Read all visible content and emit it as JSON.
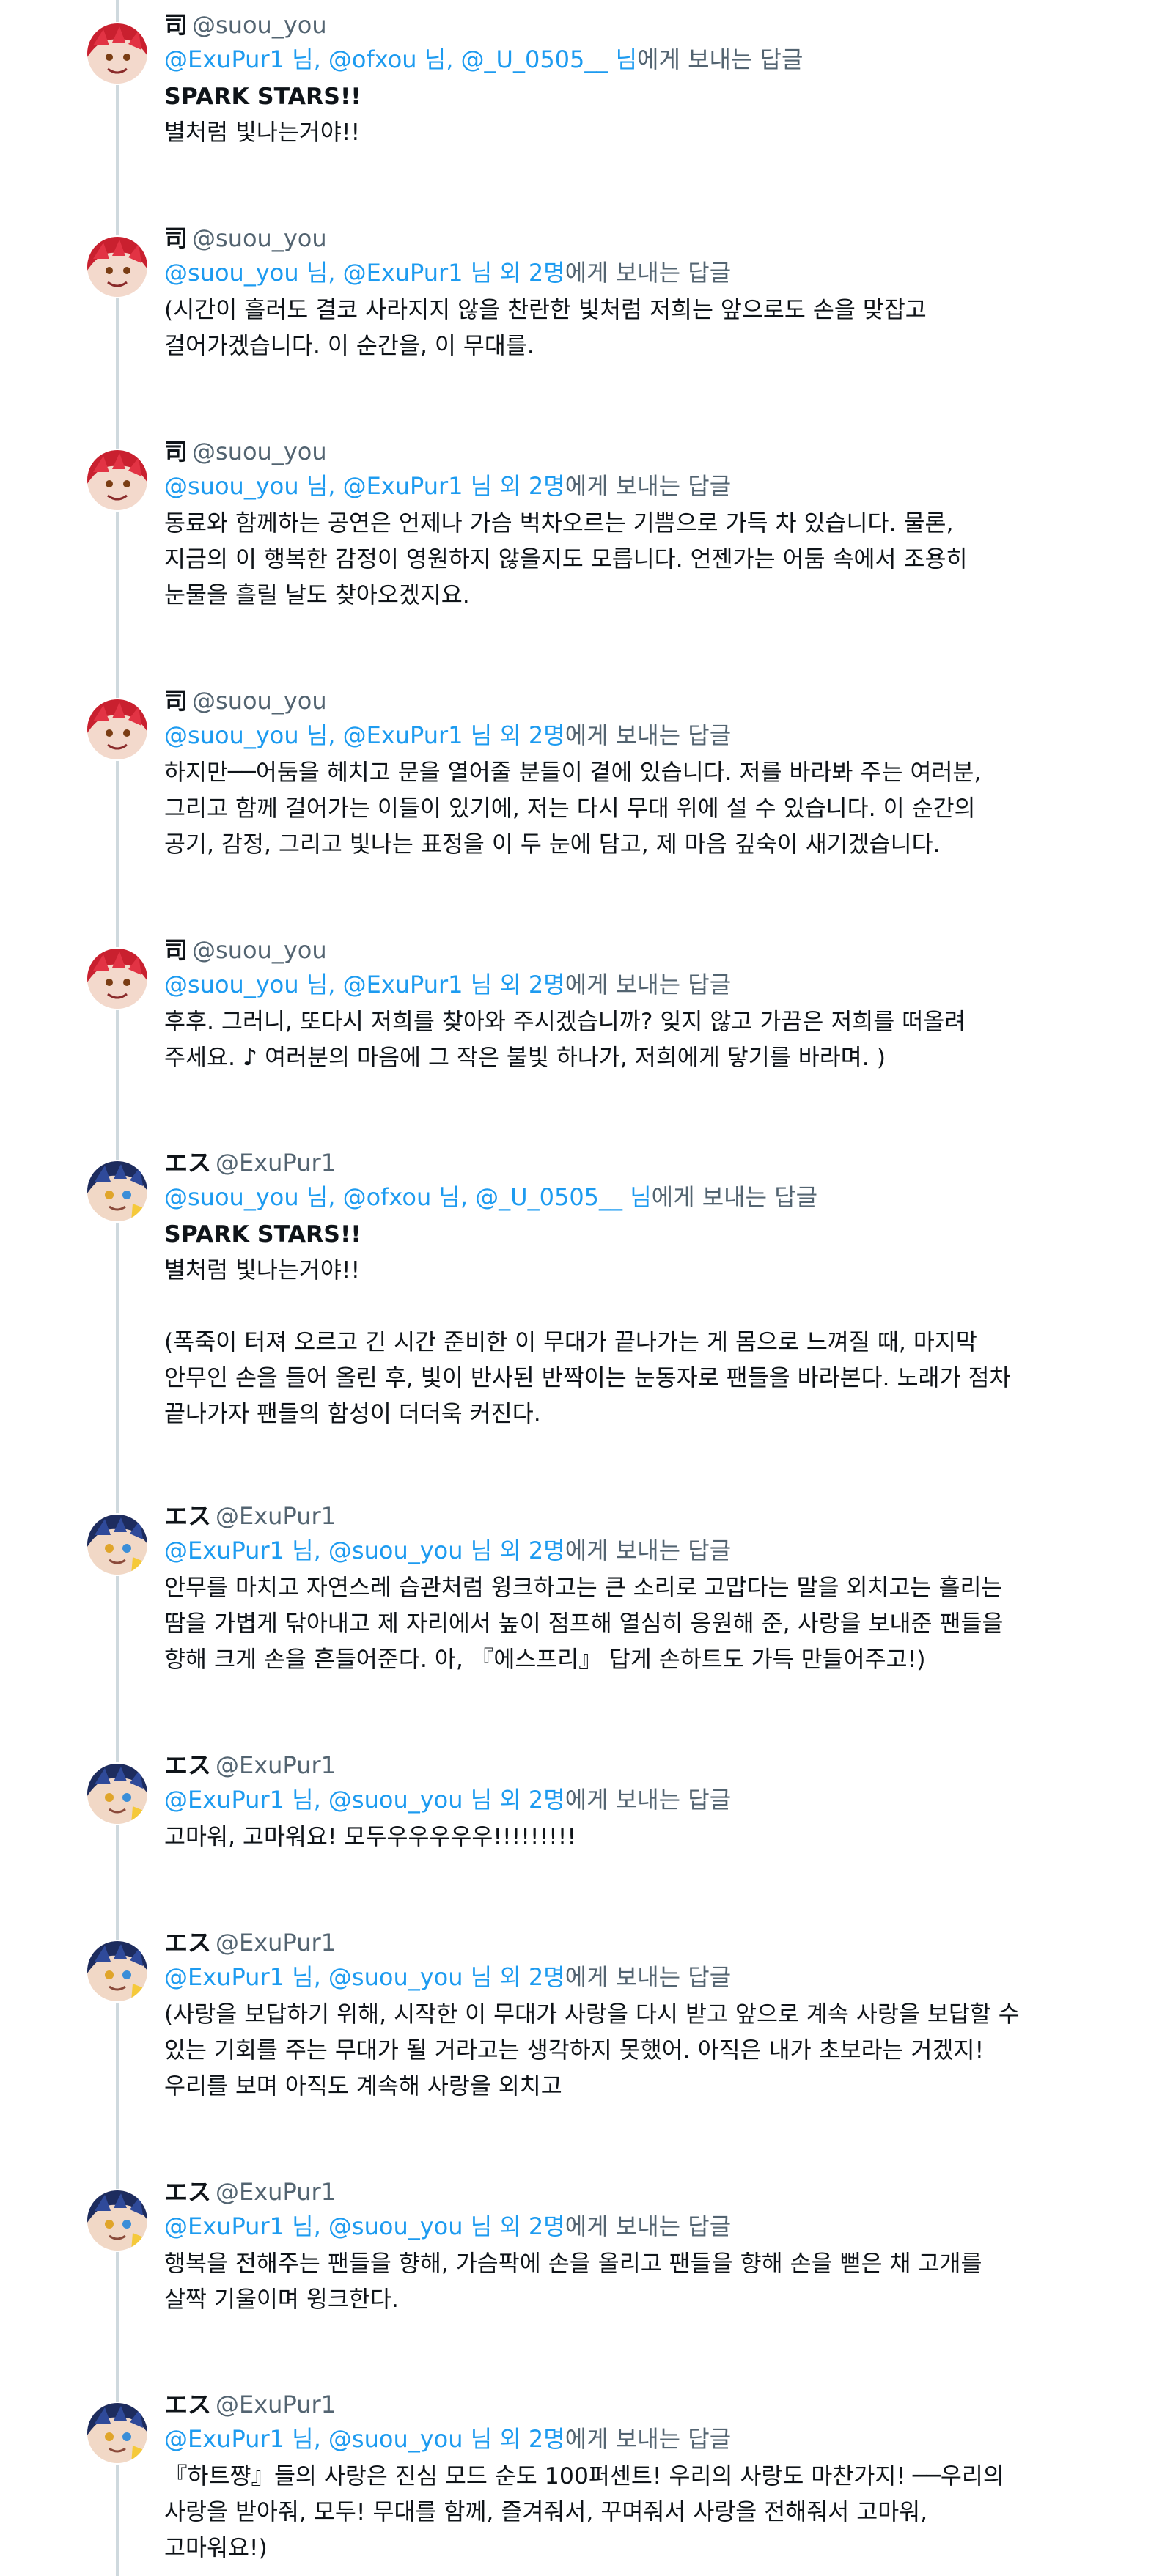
{
  "tweets": [
    {
      "name": "司",
      "handle": "@suou_you",
      "avatar": "red",
      "reply_mention": "@ExuPur1 님, @ofxou 님, @_U_0505__ 님",
      "reply_suffix": "에게 보내는 답글",
      "lines": [
        "SPARK STARS!!",
        "별처럼 빛나는거야!!"
      ]
    },
    {
      "name": "司",
      "handle": "@suou_you",
      "avatar": "red",
      "reply_mention": "@suou_you 님, @ExuPur1 님 외 2명",
      "reply_suffix": "에게 보내는 답글",
      "lines": [
        "(시간이 흘러도 결코 사라지지 않을 찬란한 빛처럼 저희는 앞으로도 손을 맞잡고",
        "걸어가겠습니다. 이 순간을, 이 무대를."
      ]
    },
    {
      "name": "司",
      "handle": "@suou_you",
      "avatar": "red",
      "reply_mention": "@suou_you 님, @ExuPur1 님 외 2명",
      "reply_suffix": "에게 보내는 답글",
      "lines": [
        "동료와 함께하는 공연은 언제나 가슴 벅차오르는 기쁨으로 가득 차 있습니다. 물론,",
        "지금의 이 행복한 감정이 영원하지 않을지도 모릅니다. 언젠가는 어둠 속에서 조용히",
        "눈물을 흘릴 날도 찾아오겠지요."
      ]
    },
    {
      "name": "司",
      "handle": "@suou_you",
      "avatar": "red",
      "reply_mention": "@suou_you 님, @ExuPur1 님 외 2명",
      "reply_suffix": "에게 보내는 답글",
      "lines": [
        "하지만──어둠을 헤치고 문을 열어줄 분들이 곁에 있습니다. 저를 바라봐 주는 여러분,",
        "그리고 함께 걸어가는 이들이 있기에, 저는 다시 무대 위에 설 수 있습니다. 이 순간의",
        "공기, 감정, 그리고 빛나는 표정을 이 두 눈에 담고, 제 마음 깊숙이 새기겠습니다."
      ]
    },
    {
      "name": "司",
      "handle": "@suou_you",
      "avatar": "red",
      "reply_mention": "@suou_you 님, @ExuPur1 님 외 2명",
      "reply_suffix": "에게 보내는 답글",
      "lines": [
        "후후. 그러니, 또다시 저희를 찾아와 주시겠습니까? 잊지 않고 가끔은 저희를 떠올려",
        "주세요. ♪ 여러분의 마음에 그 작은 불빛 하나가, 저희에게 닿기를 바라며. )"
      ]
    },
    {
      "name": "エス",
      "handle": "@ExuPur1",
      "avatar": "blue",
      "reply_mention": "@suou_you 님, @ofxou 님, @_U_0505__ 님",
      "reply_suffix": "에게 보내는 답글",
      "lines": [
        "SPARK STARS!!",
        "별처럼 빛나는거야!!",
        "",
        "(폭죽이 터져 오르고 긴 시간 준비한 이 무대가 끝나가는 게 몸으로 느껴질 때, 마지막",
        "안무인 손을 들어 올린 후, 빛이 반사된 반짝이는 눈동자로 팬들을 바라본다. 노래가 점차",
        "끝나가자 팬들의 함성이 더더욱 커진다."
      ]
    },
    {
      "name": "エス",
      "handle": "@ExuPur1",
      "avatar": "blue",
      "reply_mention": "@ExuPur1 님, @suou_you 님 외 2명",
      "reply_suffix": "에게 보내는 답글",
      "lines": [
        "안무를 마치고 자연스레 습관처럼 윙크하고는 큰 소리로 고맙다는 말을 외치고는 흘리는",
        "땀을 가볍게 닦아내고 제 자리에서 높이 점프해 열심히 응원해 준, 사랑을 보내준 팬들을",
        "향해 크게 손을 흔들어준다. 아, 『에스프리』 답게 손하트도 가득 만들어주고!)"
      ]
    },
    {
      "name": "エス",
      "handle": "@ExuPur1",
      "avatar": "blue",
      "reply_mention": "@ExuPur1 님, @suou_you 님 외 2명",
      "reply_suffix": "에게 보내는 답글",
      "lines": [
        "고마워, 고마워요! 모두우우우우우!!!!!!!!!"
      ]
    },
    {
      "name": "エス",
      "handle": "@ExuPur1",
      "avatar": "blue",
      "reply_mention": "@ExuPur1 님, @suou_you 님 외 2명",
      "reply_suffix": "에게 보내는 답글",
      "lines": [
        "(사랑을 보답하기 위해, 시작한 이 무대가 사랑을 다시 받고 앞으로 계속 사랑을 보답할 수",
        "있는 기회를 주는 무대가 될 거라고는 생각하지 못했어. 아직은 내가 초보라는 거겠지!",
        "우리를 보며 아직도 계속해 사랑을 외치고"
      ]
    },
    {
      "name": "エス",
      "handle": "@ExuPur1",
      "avatar": "blue",
      "reply_mention": "@ExuPur1 님, @suou_you 님 외 2명",
      "reply_suffix": "에게 보내는 답글",
      "lines": [
        "행복을 전해주는 팬들을 향해, 가슴팍에 손을 올리고 팬들을 향해 손을 뻗은 채 고개를",
        "살짝 기울이며 윙크한다."
      ]
    },
    {
      "name": "エス",
      "handle": "@ExuPur1",
      "avatar": "blue",
      "reply_mention": "@ExuPur1 님, @suou_you 님 외 2명",
      "reply_suffix": "에게 보내는 답글",
      "lines": [
        "『하트쨩』들의 사랑은 진심 모드 순도 100퍼센트! 우리의 사랑도 마찬가지! ──우리의",
        "사랑을 받아줘, 모두! 무대를 함께, 즐겨줘서, 꾸며줘서 사랑을 전해줘서 고마워,",
        "고마워요!)"
      ]
    }
  ]
}
